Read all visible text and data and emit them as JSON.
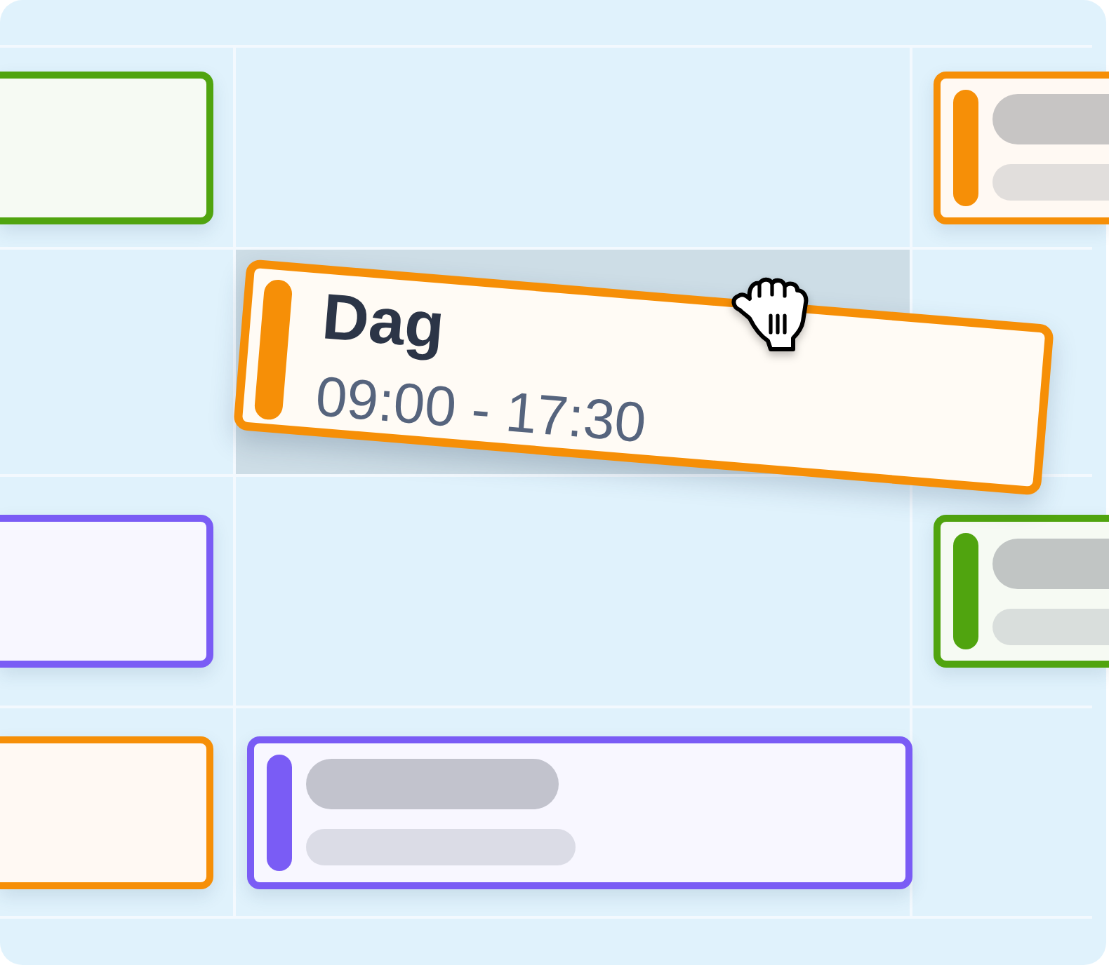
{
  "calendar": {
    "rows": [
      {
        "cells": [
          {
            "kind": "shift",
            "color": "#50a40f",
            "skeleton": false
          },
          {
            "kind": "empty"
          },
          {
            "kind": "shift",
            "color": "#f68f07",
            "skeleton": true
          }
        ]
      },
      {
        "cells": [
          {
            "kind": "empty"
          },
          {
            "kind": "drop_target"
          },
          {
            "kind": "empty"
          }
        ]
      },
      {
        "cells": [
          {
            "kind": "shift",
            "color": "#7a5cf5",
            "skeleton": false
          },
          {
            "kind": "empty"
          },
          {
            "kind": "shift",
            "color": "#50a40f",
            "skeleton": true
          }
        ]
      },
      {
        "cells": [
          {
            "kind": "shift",
            "color": "#f68f07",
            "skeleton": false
          },
          {
            "kind": "shift",
            "color": "#7a5cf5",
            "skeleton": true
          },
          {
            "kind": "empty"
          }
        ]
      }
    ]
  },
  "dragged_shift": {
    "title": "Dag",
    "time": "09:00 - 17:30",
    "color": "#f68f07"
  }
}
